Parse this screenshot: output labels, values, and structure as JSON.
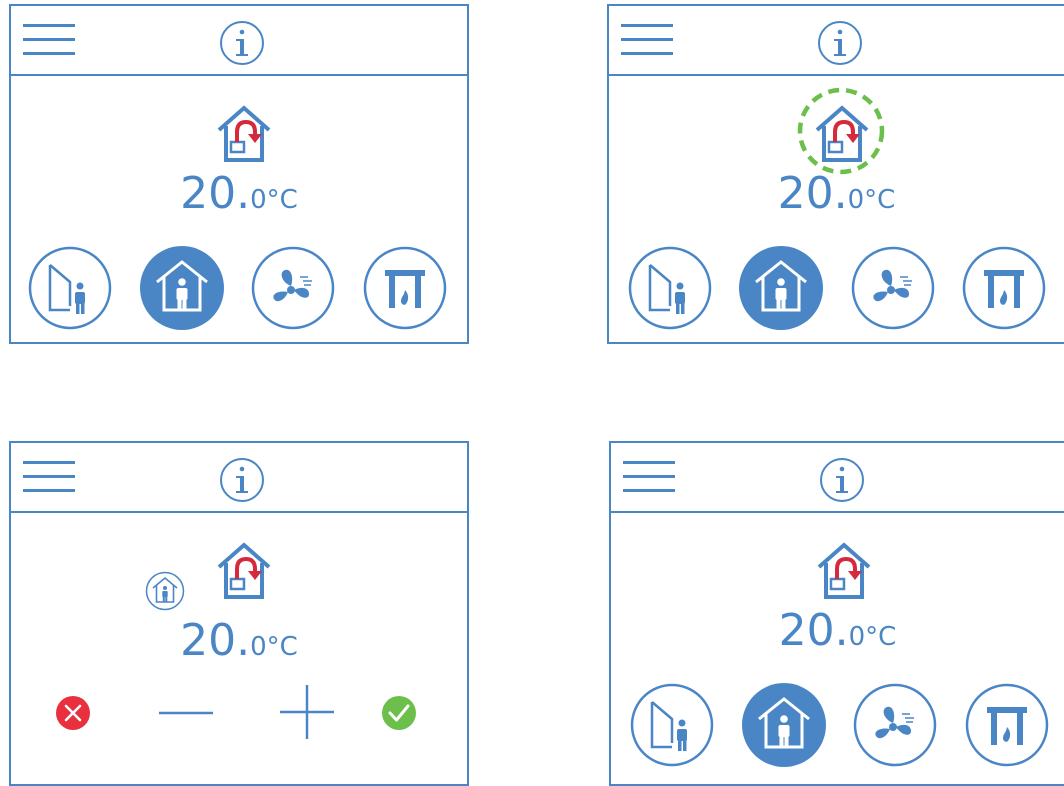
{
  "colors": {
    "accent": "#4a86c5",
    "arrow": "#d42a3c",
    "highlight": "#6cbf4a",
    "cancel": "#e8303f",
    "confirm": "#6cbf4a"
  },
  "panels": [
    {
      "id": "p1",
      "temperature": {
        "whole": "20.",
        "unit": "0°C"
      },
      "active_mode": "home",
      "mode_buttons": [
        "away-mode",
        "home-mode",
        "boost-mode",
        "fireplace-mode"
      ]
    },
    {
      "id": "p2",
      "temperature": {
        "whole": "20.",
        "unit": "0°C"
      },
      "active_mode": "home",
      "highlighted": "recirculation-icon"
    },
    {
      "id": "p3",
      "temperature": {
        "whole": "20.",
        "unit": "0°C"
      },
      "controls": [
        "cancel",
        "decrease",
        "increase",
        "confirm"
      ]
    },
    {
      "id": "p4",
      "temperature": {
        "whole": "20.",
        "unit": "0°C"
      },
      "active_mode": "home"
    }
  ],
  "icons": {
    "menu": "hamburger-menu-icon",
    "info": "info-icon",
    "mode": "house-recirculation-icon",
    "away": "away-person-door-icon",
    "home": "home-person-icon",
    "boost": "fan-icon",
    "fireplace": "fireplace-icon"
  }
}
